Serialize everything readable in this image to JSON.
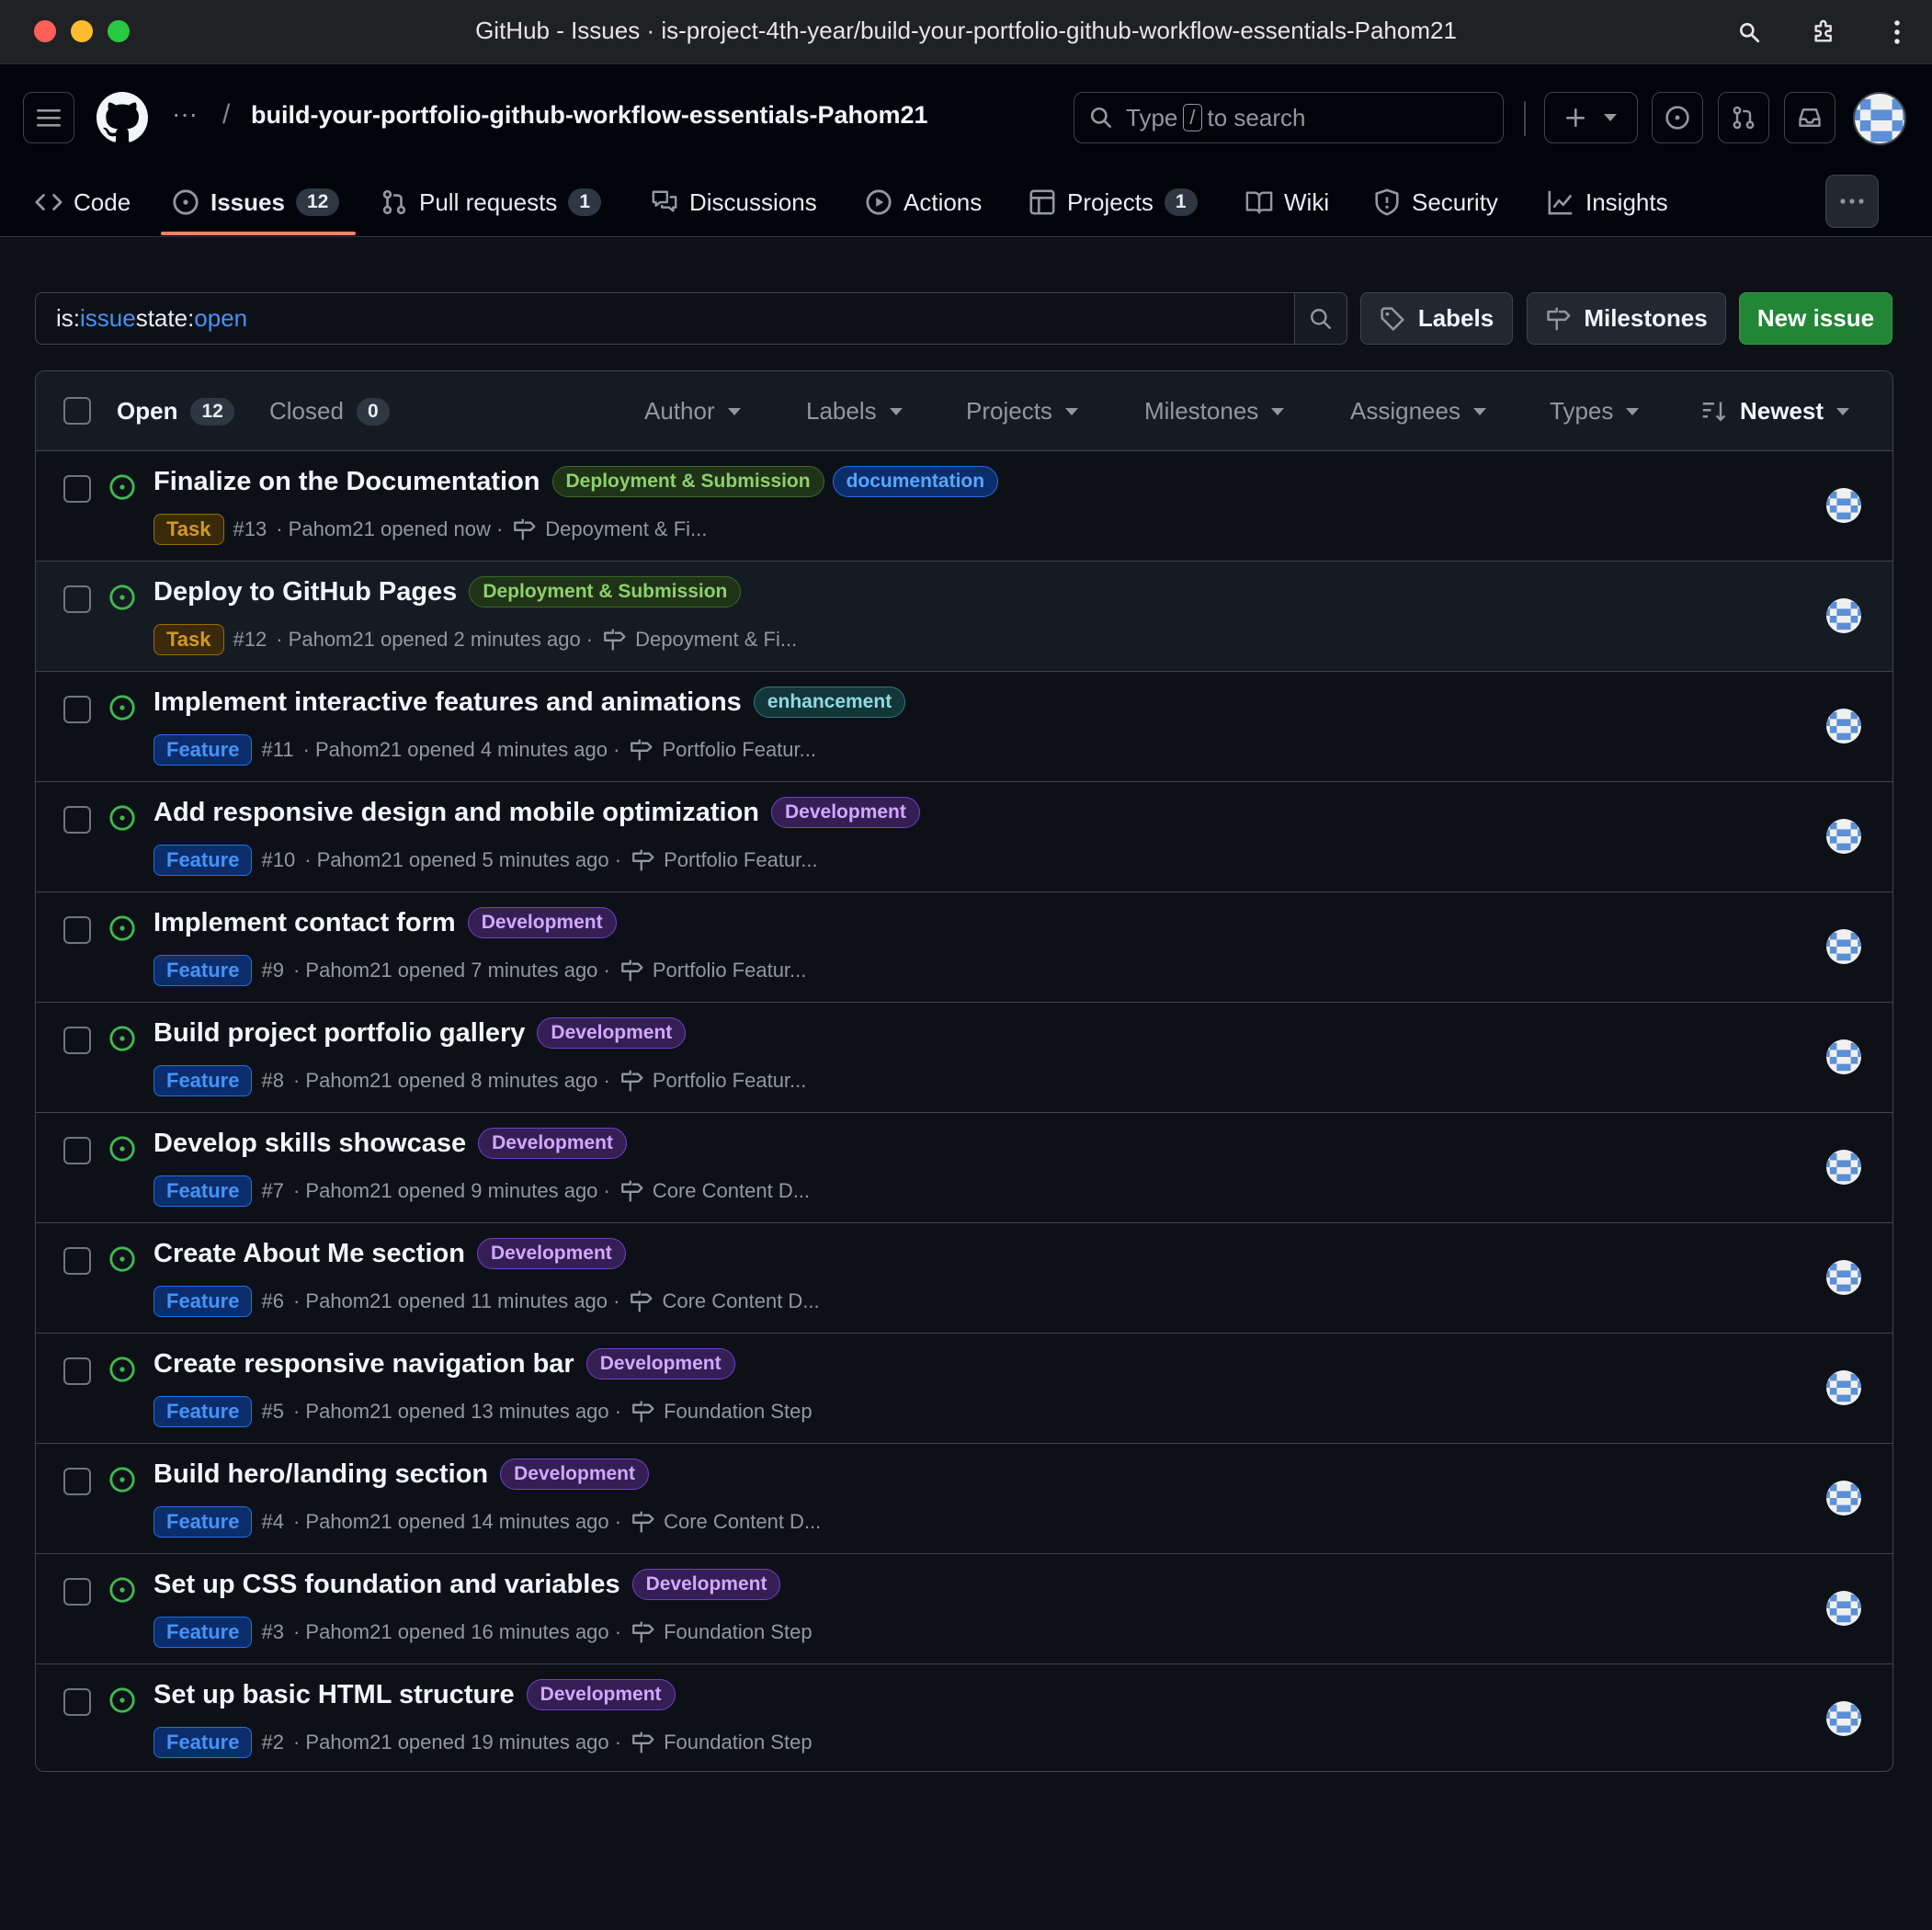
{
  "window": {
    "title": "GitHub - Issues · is-project-4th-year/build-your-portfolio-github-workflow-essentials-Pahom21"
  },
  "header": {
    "ellipsis": "···",
    "slash": "/",
    "repo": "build-your-portfolio-github-workflow-essentials-Pahom21",
    "search": {
      "prefix": "Type",
      "kbd": "/",
      "suffix": "to search"
    }
  },
  "tabs": [
    {
      "label": "Code",
      "icon": "code-icon"
    },
    {
      "label": "Issues",
      "count": "12",
      "icon": "issue-opened-icon"
    },
    {
      "label": "Pull requests",
      "count": "1",
      "icon": "git-pull-request-icon"
    },
    {
      "label": "Discussions",
      "icon": "comment-discussion-icon"
    },
    {
      "label": "Actions",
      "icon": "play-icon"
    },
    {
      "label": "Projects",
      "count": "1",
      "icon": "table-icon"
    },
    {
      "label": "Wiki",
      "icon": "book-icon"
    },
    {
      "label": "Security",
      "icon": "shield-icon"
    },
    {
      "label": "Insights",
      "icon": "graph-icon"
    }
  ],
  "toolbar": {
    "query": {
      "is": "is:",
      "issue": "issue",
      "state": " state:",
      "open": "open"
    },
    "labels_btn": "Labels",
    "milestones_btn": "Milestones",
    "new_issue_btn": "New issue"
  },
  "list_header": {
    "open_label": "Open",
    "open_count": "12",
    "closed_label": "Closed",
    "closed_count": "0",
    "filters": [
      "Author",
      "Labels",
      "Projects",
      "Milestones",
      "Assignees",
      "Types"
    ],
    "sort": "Newest"
  },
  "issues": [
    {
      "title": "Finalize on the Documentation",
      "labels": [
        "Deployment & Submission",
        "documentation"
      ],
      "type": "Task",
      "number": "#13",
      "meta": "· Pahom21 opened now ·",
      "milestone": "Depoyment & Fi..."
    },
    {
      "title": "Deploy to GitHub Pages",
      "labels": [
        "Deployment & Submission"
      ],
      "type": "Task",
      "number": "#12",
      "meta": "· Pahom21 opened 2 minutes ago ·",
      "milestone": "Depoyment & Fi..."
    },
    {
      "title": "Implement interactive features and animations",
      "labels": [
        "enhancement"
      ],
      "type": "Feature",
      "number": "#11",
      "meta": "· Pahom21 opened 4 minutes ago ·",
      "milestone": "Portfolio Featur..."
    },
    {
      "title": "Add responsive design and mobile optimization",
      "labels": [
        "Development"
      ],
      "type": "Feature",
      "number": "#10",
      "meta": "· Pahom21 opened 5 minutes ago ·",
      "milestone": "Portfolio Featur..."
    },
    {
      "title": "Implement contact form",
      "labels": [
        "Development"
      ],
      "type": "Feature",
      "number": "#9",
      "meta": "· Pahom21 opened 7 minutes ago ·",
      "milestone": "Portfolio Featur..."
    },
    {
      "title": "Build project portfolio gallery",
      "labels": [
        "Development"
      ],
      "type": "Feature",
      "number": "#8",
      "meta": "· Pahom21 opened 8 minutes ago ·",
      "milestone": "Portfolio Featur..."
    },
    {
      "title": "Develop skills showcase",
      "labels": [
        "Development"
      ],
      "type": "Feature",
      "number": "#7",
      "meta": "· Pahom21 opened 9 minutes ago ·",
      "milestone": "Core Content D..."
    },
    {
      "title": "Create About Me section",
      "labels": [
        "Development"
      ],
      "type": "Feature",
      "number": "#6",
      "meta": "· Pahom21 opened 11 minutes ago ·",
      "milestone": "Core Content D..."
    },
    {
      "title": "Create responsive navigation bar",
      "labels": [
        "Development"
      ],
      "type": "Feature",
      "number": "#5",
      "meta": "· Pahom21 opened 13 minutes ago ·",
      "milestone": "Foundation Step"
    },
    {
      "title": "Build hero/landing section",
      "labels": [
        "Development"
      ],
      "type": "Feature",
      "number": "#4",
      "meta": "· Pahom21 opened 14 minutes ago ·",
      "milestone": "Core Content D..."
    },
    {
      "title": "Set up CSS foundation and variables",
      "labels": [
        "Development"
      ],
      "type": "Feature",
      "number": "#3",
      "meta": "· Pahom21 opened 16 minutes ago ·",
      "milestone": "Foundation Step"
    },
    {
      "title": "Set up basic HTML structure",
      "labels": [
        "Development"
      ],
      "type": "Feature",
      "number": "#2",
      "meta": "· Pahom21 opened 19 minutes ago ·",
      "milestone": "Foundation Step"
    }
  ],
  "label_colors": {
    "Deployment & Submission": {
      "fg": "#8fd06b",
      "bg": "#1f3317",
      "border": "#3c6a26"
    },
    "documentation": {
      "fg": "#58a6ff",
      "bg": "#0c2d6b",
      "border": "#1f6feb"
    },
    "enhancement": {
      "fg": "#8ddbe0",
      "bg": "#12363a",
      "border": "#2b7a80"
    },
    "Development": {
      "fg": "#d2a8ff",
      "bg": "#351e54",
      "border": "#6e40c9"
    }
  },
  "colors": {
    "open_state": "#3fb950",
    "accent_underline": "#f78166",
    "primary_button": "#238636"
  }
}
